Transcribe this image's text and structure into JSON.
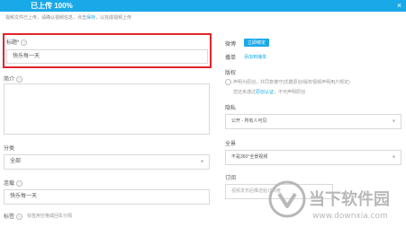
{
  "progress": {
    "text": "已上传 100%",
    "value": 1.0,
    "close": "×"
  },
  "notice": {
    "text": "视频文件已上传，请确认视频信息，点击",
    "link": "保存",
    "suffix": "，以完成视频上传"
  },
  "left": {
    "title_label": "标题*",
    "title_value": "快乐每一天",
    "intro_label": "简介",
    "category_label": "分类",
    "category_value": "全部",
    "series_label": "连载",
    "series_value": "快乐每一天",
    "tags_label": "标签",
    "tags_placeholder": "标签用空格或回车分隔"
  },
  "right": {
    "weibo_label": "微博",
    "weibo_button": "立即绑定",
    "playlist_label": "播单",
    "playlist_link": "添加到播单",
    "copyright_label": "版权",
    "copyright_option": "声明为原创，并同意遵守",
    "copyright_option2": "(优酷原创/版权视频声明用户规定)",
    "copyright_sub": "您还未通过",
    "copyright_sub_link": "原创认证",
    "copyright_sub_tail": "，不可声明原创",
    "privacy_label": "隐私",
    "privacy_value": "公开 - 所有人可见",
    "panorama_label": "全景",
    "panorama_value": "不是360°全景视频",
    "subscribe_label": "订阅",
    "subscribe_value": "视频发布后推送给订阅者"
  },
  "watermark": {
    "text1": "当下软件园",
    "text2": "www.downxia.com"
  },
  "colors": {
    "accent": "#1aa9e8",
    "highlight_border": "#e3242b"
  }
}
